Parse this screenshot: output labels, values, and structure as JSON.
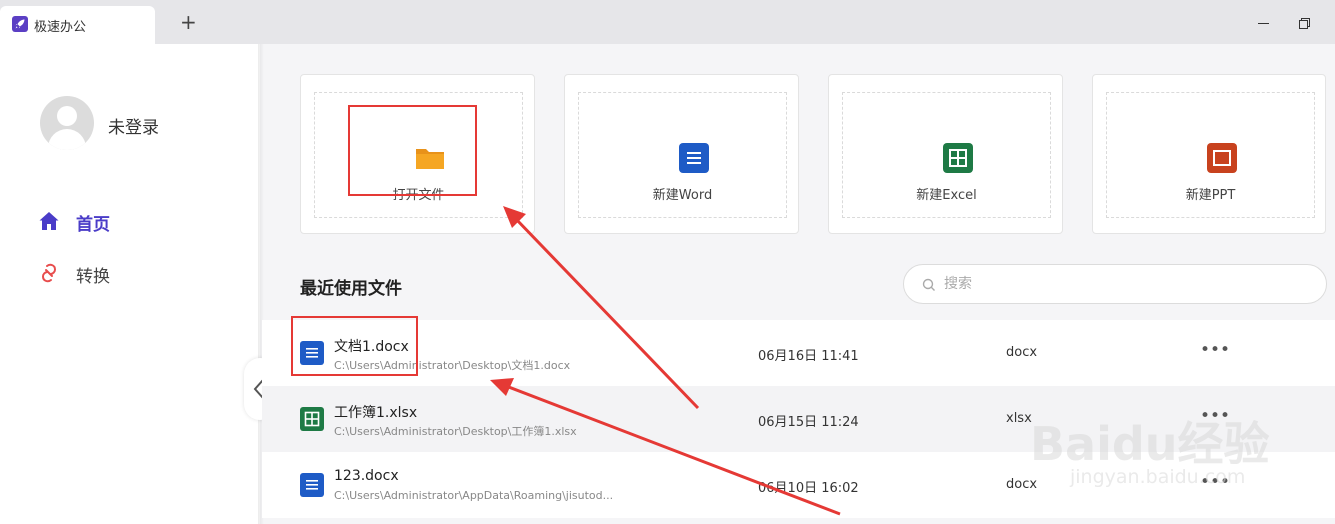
{
  "tab": {
    "title": "极速办公",
    "new_tab": "+"
  },
  "user": {
    "name": "未登录"
  },
  "nav": [
    {
      "label": "首页",
      "icon": "home-icon",
      "active": true
    },
    {
      "label": "转换",
      "icon": "convert-icon",
      "active": false
    }
  ],
  "actions": [
    {
      "label": "打开文件",
      "icon": "folder-icon"
    },
    {
      "label": "新建Word",
      "icon": "word-icon"
    },
    {
      "label": "新建Excel",
      "icon": "excel-icon"
    },
    {
      "label": "新建PPT",
      "icon": "ppt-icon"
    }
  ],
  "recent": {
    "title": "最近使用文件",
    "search_placeholder": "搜索",
    "files": [
      {
        "name": "文档1.docx",
        "path": "C:\\Users\\Administrator\\Desktop\\文档1.docx",
        "date": "06月16日 11:41",
        "type": "docx",
        "more": "•••",
        "icon": "word-icon"
      },
      {
        "name": "工作簿1.xlsx",
        "path": "C:\\Users\\Administrator\\Desktop\\工作簿1.xlsx",
        "date": "06月15日 11:24",
        "type": "xlsx",
        "more": "•••",
        "icon": "excel-icon"
      },
      {
        "name": "123.docx",
        "path": "C:\\Users\\Administrator\\AppData\\Roaming\\jisutod...",
        "date": "06月10日 16:02",
        "type": "docx",
        "more": "•••",
        "icon": "word-icon"
      }
    ]
  },
  "watermark": {
    "text": "Baidu经验",
    "sub": "jingyan.baidu.com"
  },
  "colors": {
    "accent": "#4a3cc8",
    "word": "#1e5bc6",
    "excel": "#1e7a45",
    "ppt": "#c8421e",
    "folder": "#f5a623",
    "annotation": "#e53935"
  }
}
